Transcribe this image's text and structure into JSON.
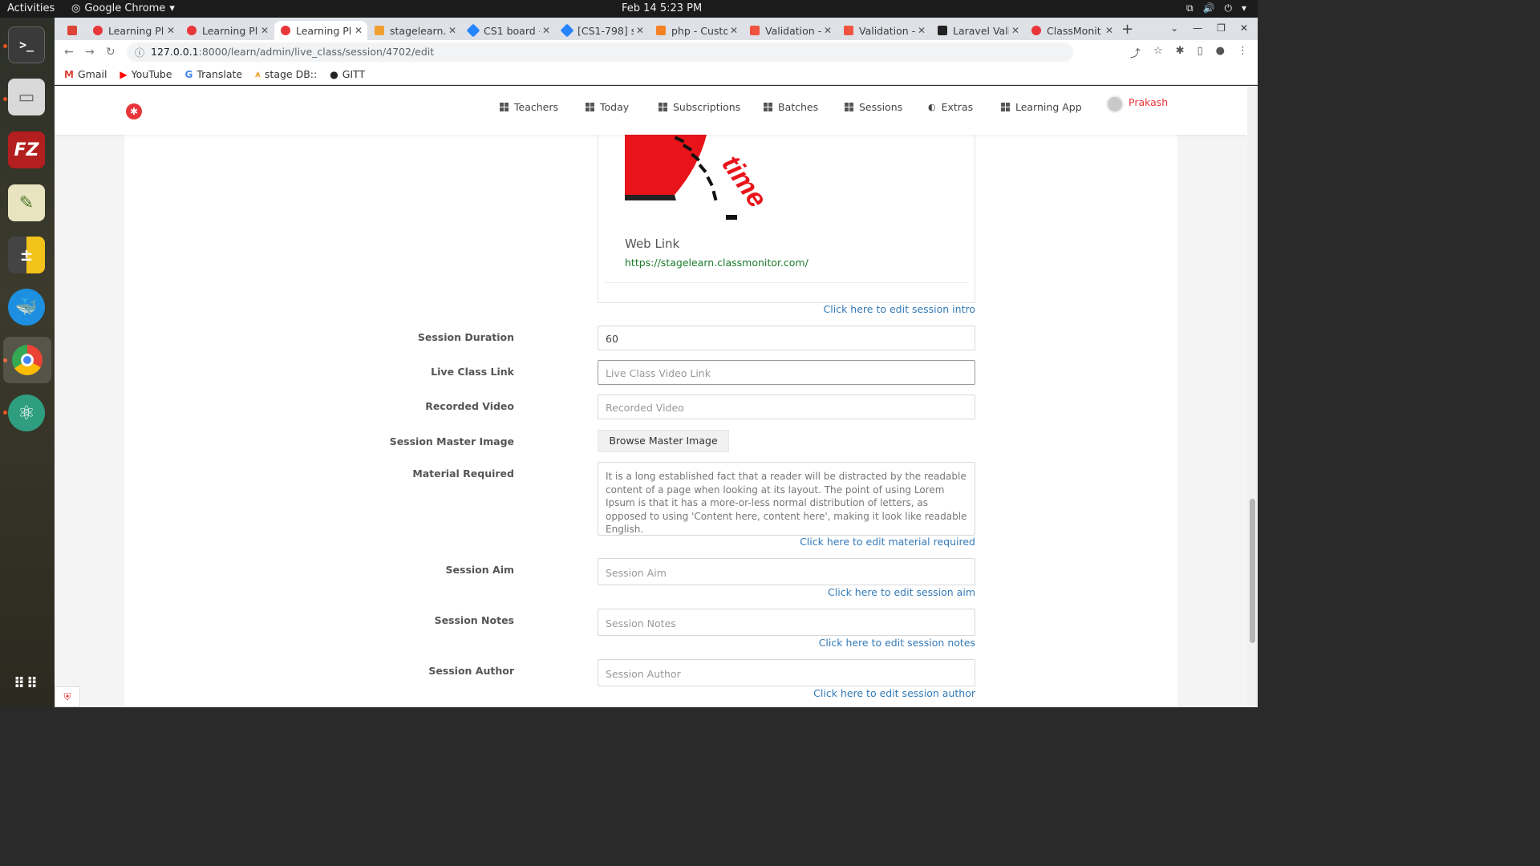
{
  "system": {
    "activities": "Activities",
    "app_name": "Google Chrome",
    "clock": "Feb 14  5:23 PM"
  },
  "dock": {
    "apps": [
      {
        "name": "terminal-icon",
        "glyph": ">_"
      },
      {
        "name": "files-icon",
        "glyph": "▭"
      },
      {
        "name": "filezilla-icon",
        "glyph": "FZ"
      },
      {
        "name": "gedit-icon",
        "glyph": "✎"
      },
      {
        "name": "calculator-icon",
        "glyph": "±"
      },
      {
        "name": "docker-icon",
        "glyph": "🐳"
      },
      {
        "name": "chrome-icon",
        "glyph": "◉"
      },
      {
        "name": "atom-icon",
        "glyph": "⚛"
      },
      {
        "name": "app-grid-icon",
        "glyph": "⋮⋮⋮"
      }
    ]
  },
  "browser": {
    "tabs": [
      {
        "label": "",
        "color": "#db4437"
      },
      {
        "label": "Learning Pl",
        "color": "#e8363b"
      },
      {
        "label": "Learning Pl",
        "color": "#e8363b"
      },
      {
        "label": "Learning Pl",
        "color": "#e8363b"
      },
      {
        "label": "stagelearn.",
        "color": "#f0a030"
      },
      {
        "label": "CS1 board -",
        "color": "#2684ff"
      },
      {
        "label": "[CS1-798] s",
        "color": "#2684ff"
      },
      {
        "label": "php - Custo",
        "color": "#f48024"
      },
      {
        "label": "Validation -",
        "color": "#f05340"
      },
      {
        "label": "Validation -",
        "color": "#f05340"
      },
      {
        "label": "Laravel Vali",
        "color": "#222222"
      },
      {
        "label": "ClassMonit",
        "color": "#e8363b"
      }
    ],
    "url_host": "127.0.0.1",
    "url_path": ":8000/learn/admin/live_class/session/4702/edit",
    "bookmarks": [
      {
        "label": "Gmail",
        "glyph": "M",
        "color": "#db4437"
      },
      {
        "label": "YouTube",
        "glyph": "▶",
        "color": "#ff0000"
      },
      {
        "label": "Translate",
        "glyph": "G",
        "color": "#4285f4"
      },
      {
        "label": "stage DB::",
        "glyph": "⩚",
        "color": "#f0a030"
      },
      {
        "label": "GITT",
        "glyph": "●",
        "color": "#222222"
      }
    ]
  },
  "navbar": {
    "items": [
      "Teachers",
      "Today",
      "Subscriptions",
      "Batches",
      "Sessions",
      "Extras",
      "Learning App"
    ],
    "user": "Prakash",
    "accent": "#e8363b"
  },
  "intro": {
    "web_link_label": "Web Link",
    "web_link_url": "https://stagelearn.classmonitor.com/",
    "image_text": "time",
    "edit_link": "Click here to edit session intro"
  },
  "form": {
    "duration": {
      "label": "Session Duration",
      "value": "60"
    },
    "live_link": {
      "label": "Live Class Link",
      "placeholder": "Live Class Video Link"
    },
    "recorded": {
      "label": "Recorded Video",
      "placeholder": "Recorded Video"
    },
    "master_image": {
      "label": "Session Master Image",
      "button": "Browse Master Image"
    },
    "material": {
      "label": "Material Required",
      "value": "It is a long established fact that a reader will be distracted by the readable content of a page when looking at its layout. The point of using Lorem Ipsum is that it has a more-or-less normal distribution of letters, as opposed to using 'Content here, content here', making it look like readable English.",
      "edit_link": "Click here to edit material required"
    },
    "aim": {
      "label": "Session Aim",
      "placeholder": "Session Aim",
      "edit_link": "Click here to edit session aim"
    },
    "notes": {
      "label": "Session Notes",
      "placeholder": "Session Notes",
      "edit_link": "Click here to edit session notes"
    },
    "author": {
      "label": "Session Author",
      "placeholder": "Session Author",
      "edit_link": "Click here to edit session author"
    }
  }
}
